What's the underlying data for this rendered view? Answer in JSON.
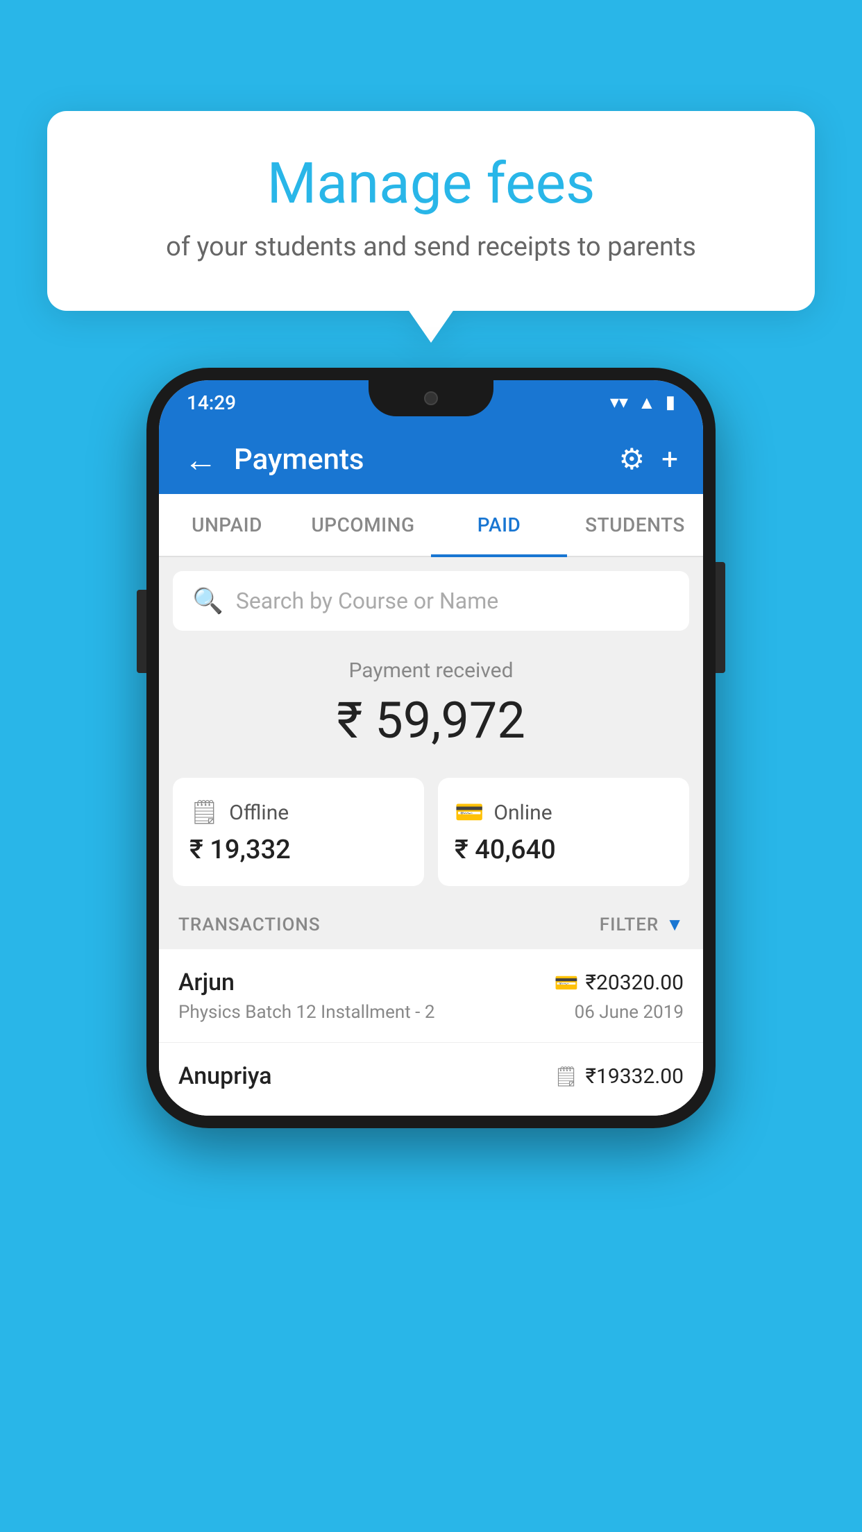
{
  "bubble": {
    "title": "Manage fees",
    "subtitle": "of your students and send receipts to parents"
  },
  "status_bar": {
    "time": "14:29",
    "wifi_icon": "▼",
    "signal_icon": "▲",
    "battery_icon": "▮"
  },
  "app_bar": {
    "back_icon": "←",
    "title": "Payments",
    "settings_icon": "⚙",
    "add_icon": "+"
  },
  "tabs": [
    {
      "label": "UNPAID",
      "active": false
    },
    {
      "label": "UPCOMING",
      "active": false
    },
    {
      "label": "PAID",
      "active": true
    },
    {
      "label": "STUDENTS",
      "active": false
    }
  ],
  "search": {
    "placeholder": "Search by Course or Name"
  },
  "payment_summary": {
    "label": "Payment received",
    "amount": "₹ 59,972"
  },
  "offline_card": {
    "icon": "💳",
    "label": "Offline",
    "amount": "₹ 19,332"
  },
  "online_card": {
    "icon": "💳",
    "label": "Online",
    "amount": "₹ 40,640"
  },
  "transactions_section": {
    "label": "TRANSACTIONS",
    "filter_label": "FILTER"
  },
  "transactions": [
    {
      "name": "Arjun",
      "icon": "💳",
      "amount": "₹20320.00",
      "desc": "Physics Batch 12 Installment - 2",
      "date": "06 June 2019"
    },
    {
      "name": "Anupriya",
      "icon": "💴",
      "amount": "₹19332.00",
      "desc": "",
      "date": ""
    }
  ]
}
